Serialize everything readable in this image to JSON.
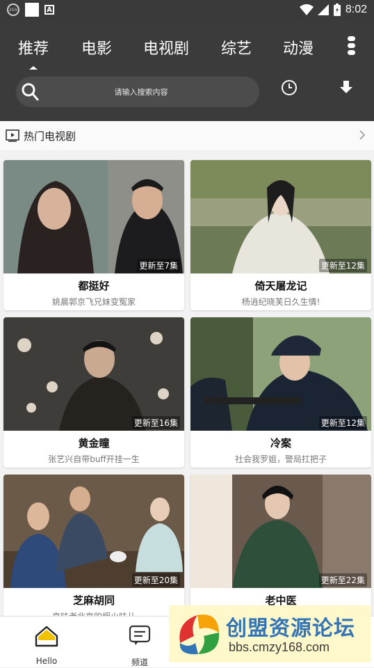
{
  "status_bar": {
    "time": "8:02",
    "label_a": "A",
    "label_small": "2GS"
  },
  "tabs": [
    {
      "label": "推荐",
      "active": true
    },
    {
      "label": "电影"
    },
    {
      "label": "电视剧"
    },
    {
      "label": "综艺"
    },
    {
      "label": "动漫"
    }
  ],
  "search": {
    "placeholder": "请输入搜索内容"
  },
  "section": {
    "title": "热门电视剧"
  },
  "cards": [
    {
      "title": "都挺好",
      "subtitle": "姚晨郭京飞兄妹变冤家",
      "badge": "更新至7集"
    },
    {
      "title": "倚天屠龙记",
      "subtitle": "杨逍纪晓芙日久生情!",
      "badge": "更新至12集"
    },
    {
      "title": "黄金瞳",
      "subtitle": "张艺兴自带buff开挂一生",
      "badge": "更新至16集"
    },
    {
      "title": "冷案",
      "subtitle": "社会我罗姐，警局扛把子",
      "badge": "更新至12集"
    },
    {
      "title": "芝麻胡同",
      "subtitle": "京味老北京的烟火味儿",
      "badge": "更新至20集"
    },
    {
      "title": "老中医",
      "subtitle": "",
      "badge": "更新至22集"
    }
  ],
  "bottom_nav": [
    {
      "label": "Hello",
      "icon": "home-icon"
    },
    {
      "label": "频道",
      "icon": "channel-icon"
    },
    {
      "label": "",
      "icon": "placeholder-icon"
    },
    {
      "label": "",
      "icon": "placeholder-icon"
    }
  ],
  "watermark": {
    "title": "创盟资源论坛",
    "url": "bbs.cmzy168.com"
  },
  "colors": {
    "topbar": "#3b3b3b",
    "statusbar": "#3a3a3a",
    "accent": "#f2c200"
  }
}
